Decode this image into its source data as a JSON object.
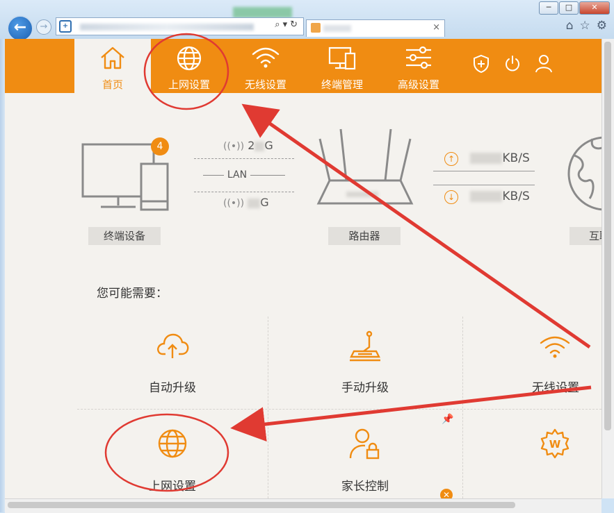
{
  "browser": {
    "window_buttons": {
      "minimize": "─",
      "maximize": "□",
      "close": "✕"
    },
    "back_glyph": "←",
    "forward_glyph": "→",
    "address_tools": "⌕▾↻",
    "tab_close": "×",
    "toolbar_icons": [
      "home-icon",
      "star-icon",
      "gear-icon"
    ],
    "toolbar_glyphs": {
      "home": "⌂",
      "favorites": "☆",
      "settings": "⚙"
    }
  },
  "nav": {
    "items": [
      {
        "label": "首页",
        "icon": "home-icon",
        "active": true
      },
      {
        "label": "上网设置",
        "icon": "globe-icon"
      },
      {
        "label": "无线设置",
        "icon": "wifi-icon"
      },
      {
        "label": "终端管理",
        "icon": "devices-icon"
      },
      {
        "label": "高级设置",
        "icon": "sliders-icon"
      }
    ],
    "right_icons": [
      "shield-icon",
      "power-icon",
      "user-icon"
    ],
    "accent": "#f08c12"
  },
  "status": {
    "terminal_badge": "4",
    "terminal_label": "终端设备",
    "band_24_suffix": "G",
    "band_24_prefix": "2",
    "lan_label": "LAN",
    "band_5_suffix": "G",
    "router_label": "路由器",
    "upload_unit": "KB/S",
    "download_unit": "KB/S",
    "internet_label": "互联"
  },
  "hint": "您可能需要：",
  "tiles": [
    {
      "label": "自动升级",
      "icon": "cloud-upload-icon"
    },
    {
      "label": "手动升级",
      "icon": "manual-upgrade-icon"
    },
    {
      "label": "无线设置",
      "icon": "wifi-icon"
    },
    {
      "label": "上网设置",
      "icon": "globe-icon"
    },
    {
      "label": "家长控制",
      "icon": "parental-lock-icon"
    },
    {
      "label": "",
      "icon": "wps-gear-icon"
    }
  ],
  "annotation_color": "#e03a32"
}
